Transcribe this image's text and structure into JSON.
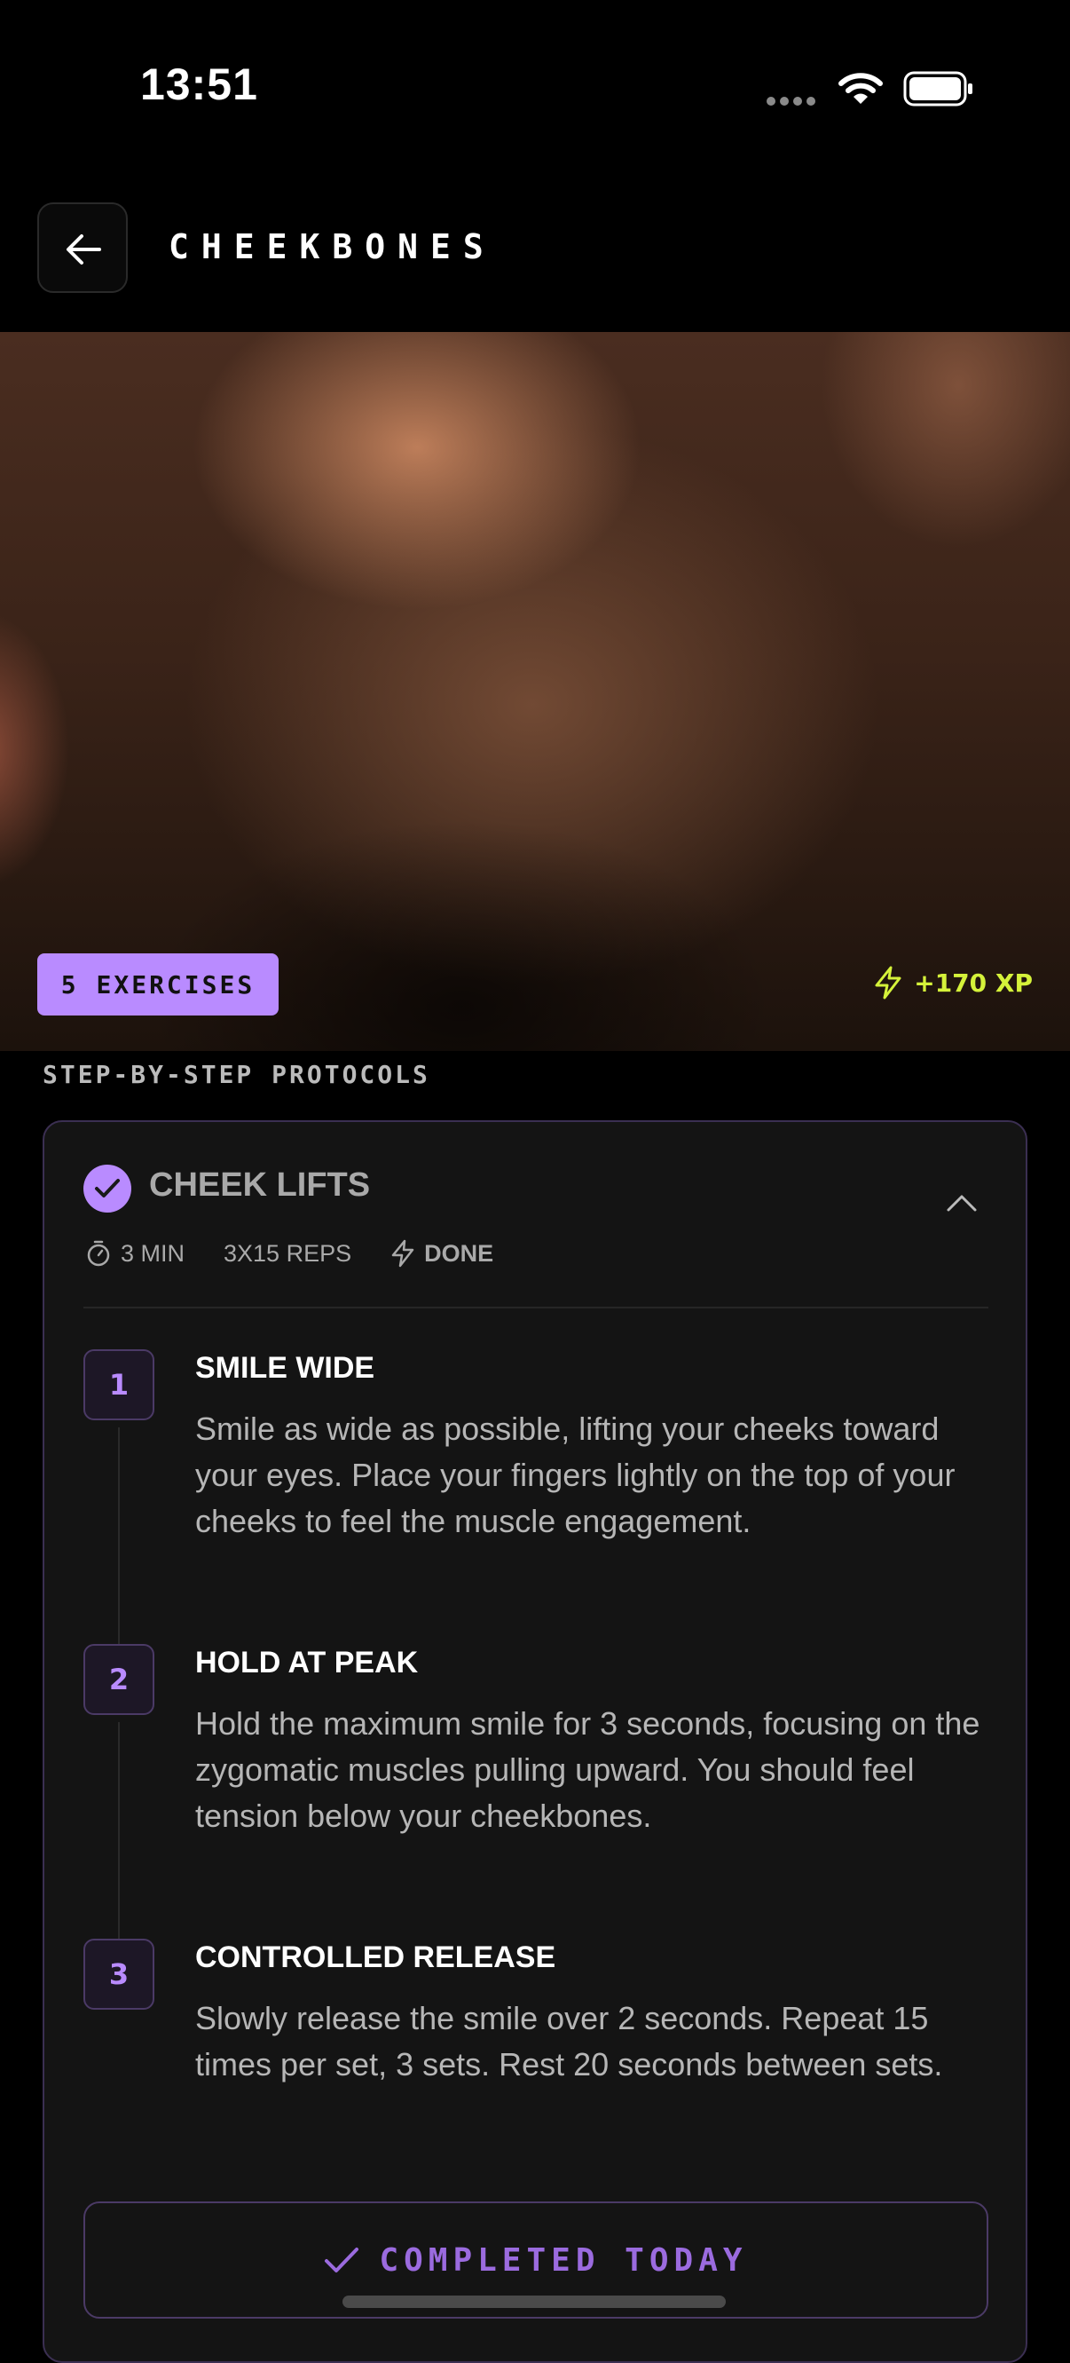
{
  "status_bar": {
    "time": "13:51"
  },
  "header": {
    "title": "CHEEKBONES"
  },
  "hero": {
    "exercises_badge": "5 EXERCISES",
    "xp": "+170 XP"
  },
  "section_label": "STEP-BY-STEP PROTOCOLS",
  "exercise": {
    "title": "CHEEK LIFTS",
    "duration": "3 MIN",
    "reps": "3X15 REPS",
    "status": "DONE",
    "steps": [
      {
        "number": "1",
        "title": "SMILE WIDE",
        "text": "Smile as wide as possible, lifting your cheeks toward your eyes. Place your fingers lightly on the top of your cheeks to feel the muscle engagement."
      },
      {
        "number": "2",
        "title": "HOLD AT PEAK",
        "text": "Hold the maximum smile for 3 seconds, focusing on the zygomatic muscles pulling upward. You should feel tension below your cheekbones."
      },
      {
        "number": "3",
        "title": "CONTROLLED RELEASE",
        "text": "Slowly release the smile over 2 seconds. Repeat 15 times per set, 3 sets. Rest 20 seconds between sets."
      }
    ],
    "completed_label": "COMPLETED TODAY"
  },
  "colors": {
    "accent": "#b98bff",
    "xp": "#d5f23a",
    "background": "#000000",
    "card": "#141414"
  }
}
